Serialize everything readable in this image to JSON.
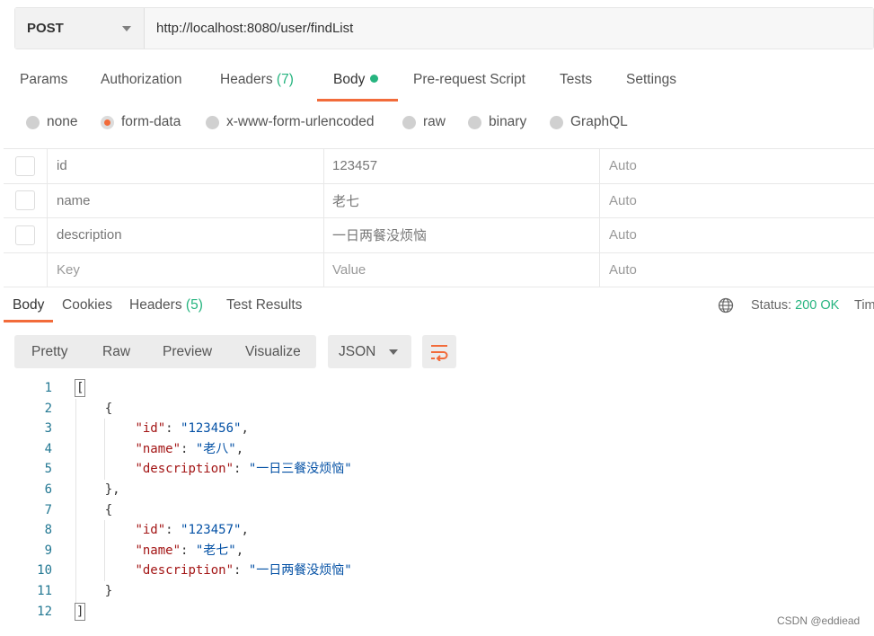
{
  "request": {
    "method": "POST",
    "url": "http://localhost:8080/user/findList"
  },
  "request_tabs": {
    "params": "Params",
    "authorization": "Authorization",
    "headers": "Headers",
    "headers_count": "(7)",
    "body": "Body",
    "prerequest": "Pre-request Script",
    "tests": "Tests",
    "settings": "Settings"
  },
  "body_types": {
    "none": "none",
    "form_data": "form-data",
    "urlencoded": "x-www-form-urlencoded",
    "raw": "raw",
    "binary": "binary",
    "graphql": "GraphQL",
    "selected": "form-data"
  },
  "form_rows": [
    {
      "key": "id",
      "value": "123457",
      "type": "Auto"
    },
    {
      "key": "name",
      "value": "老七",
      "type": "Auto"
    },
    {
      "key": "description",
      "value": "一日两餐没烦恼",
      "type": "Auto"
    }
  ],
  "form_placeholder": {
    "key": "Key",
    "value": "Value",
    "type": "Auto"
  },
  "response_tabs": {
    "body": "Body",
    "cookies": "Cookies",
    "headers": "Headers",
    "headers_count": "(5)",
    "test_results": "Test Results"
  },
  "status": {
    "label": "Status:",
    "value": "200 OK",
    "time_label": "Time"
  },
  "view_modes": {
    "pretty": "Pretty",
    "raw": "Raw",
    "preview": "Preview",
    "visualize": "Visualize"
  },
  "format": "JSON",
  "code": {
    "line_numbers": [
      "1",
      "2",
      "3",
      "4",
      "5",
      "6",
      "7",
      "8",
      "9",
      "10",
      "11",
      "12"
    ],
    "items": [
      {
        "id_key": "\"id\"",
        "id_val": "\"123456\"",
        "name_key": "\"name\"",
        "name_val": "\"老八\"",
        "desc_key": "\"description\"",
        "desc_val": "\"一日三餐没烦恼\""
      },
      {
        "id_key": "\"id\"",
        "id_val": "\"123457\"",
        "name_key": "\"name\"",
        "name_val": "\"老七\"",
        "desc_key": "\"description\"",
        "desc_val": "\"一日两餐没烦恼\""
      }
    ]
  },
  "watermark": "CSDN @eddiead",
  "colors": {
    "accent": "#f26b3a",
    "success": "#26b47f"
  }
}
